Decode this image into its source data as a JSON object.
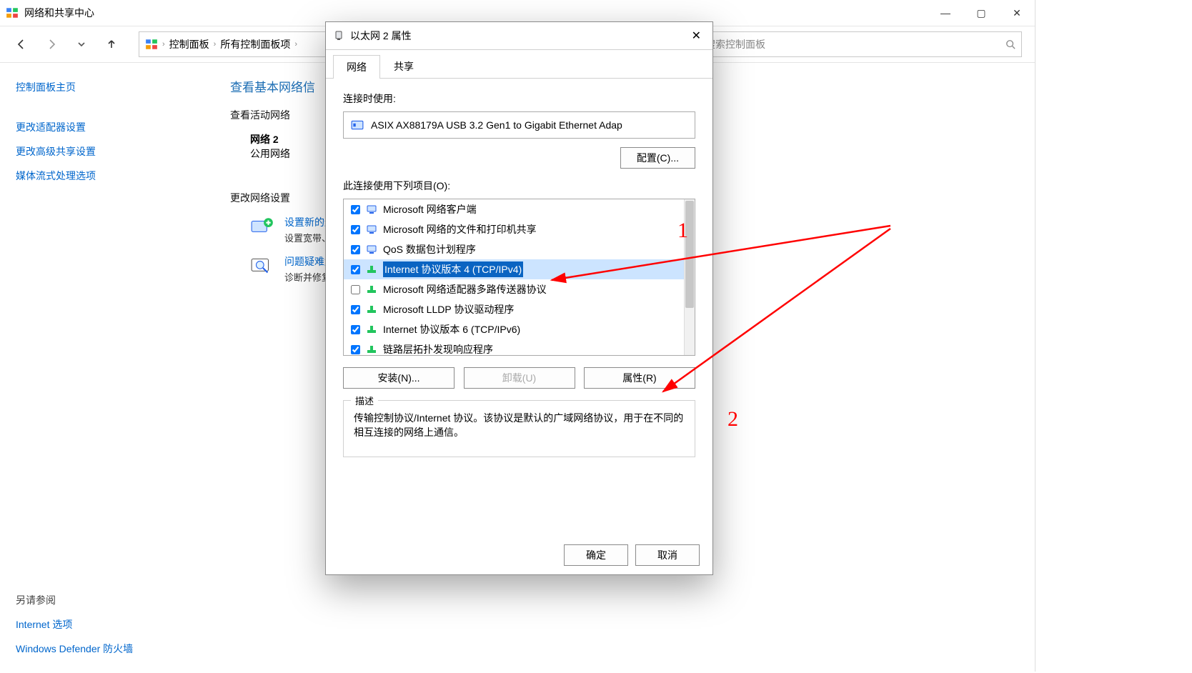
{
  "window": {
    "title": "网络和共享中心"
  },
  "nav": {
    "breadcrumb": [
      "控制面板",
      "所有控制面板项"
    ],
    "search_placeholder": "搜索控制面板"
  },
  "sidebar": {
    "home": "控制面板主页",
    "links": [
      "更改适配器设置",
      "更改高级共享设置",
      "媒体流式处理选项"
    ],
    "see_also_header": "另请参阅",
    "see_also": [
      "Internet 选项",
      "Windows Defender 防火墙"
    ]
  },
  "main": {
    "heading": "查看基本网络信",
    "view_active": "查看活动网络",
    "network_name": "网络 2",
    "network_type": "公用网络",
    "change_header": "更改网络设置",
    "setup": {
      "title": "设置新的连",
      "desc": "设置宽带、"
    },
    "trouble": {
      "title": "问题疑难解",
      "desc": "诊断并修复"
    }
  },
  "dialog": {
    "title": "以太网 2 属性",
    "tabs": {
      "network": "网络",
      "share": "共享"
    },
    "connect_using": "连接时使用:",
    "adapter": "ASIX AX88179A USB 3.2 Gen1 to Gigabit Ethernet Adap",
    "configure": "配置(C)...",
    "items_label": "此连接使用下列项目(O):",
    "items": [
      {
        "checked": true,
        "label": "Microsoft 网络客户端",
        "icon": "monitor"
      },
      {
        "checked": true,
        "label": "Microsoft 网络的文件和打印机共享",
        "icon": "monitor"
      },
      {
        "checked": true,
        "label": "QoS 数据包计划程序",
        "icon": "monitor"
      },
      {
        "checked": true,
        "label": "Internet 协议版本 4 (TCP/IPv4)",
        "icon": "net",
        "selected": true
      },
      {
        "checked": false,
        "label": "Microsoft 网络适配器多路传送器协议",
        "icon": "net"
      },
      {
        "checked": true,
        "label": "Microsoft LLDP 协议驱动程序",
        "icon": "net"
      },
      {
        "checked": true,
        "label": "Internet 协议版本 6 (TCP/IPv6)",
        "icon": "net"
      },
      {
        "checked": true,
        "label": "链路层拓扑发现响应程序",
        "icon": "net"
      }
    ],
    "install": "安装(N)...",
    "uninstall": "卸载(U)",
    "properties": "属性(R)",
    "desc_header": "描述",
    "desc_text": "传输控制协议/Internet 协议。该协议是默认的广域网络协议，用于在不同的相互连接的网络上通信。",
    "ok": "确定",
    "cancel": "取消"
  },
  "annotations": {
    "one": "1",
    "two": "2"
  }
}
